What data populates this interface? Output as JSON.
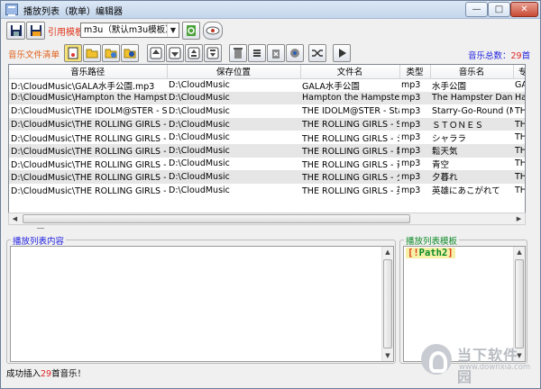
{
  "window": {
    "title": "播放列表（歌单）编辑器",
    "min_glyph": "—",
    "max_glyph": "□",
    "close_glyph": "✕"
  },
  "toolbar": {
    "template_label": "引用模板",
    "template_value": "m3u（默认m3u模板）",
    "buttons": [
      "save-icon",
      "save-as-icon",
      "refresh-icon",
      "view-icon"
    ]
  },
  "files_section": {
    "label": "音乐文件清单",
    "total_label": "音乐总数：",
    "total_value": "29",
    "total_unit": "首",
    "tools": [
      "add-file-icon",
      "add-folder-icon",
      "add-multi-icon",
      "settings-icon",
      "move-top-icon",
      "move-down-icon",
      "move-up-icon",
      "move-bottom-icon",
      "delete-icon",
      "sort-icon",
      "clear-icon",
      "shuffle-icon",
      "play-icon"
    ]
  },
  "table": {
    "columns": [
      "音乐路径",
      "保存位置",
      "文件名",
      "类型",
      "音乐名",
      "专"
    ],
    "rows": [
      [
        "D:\\CloudMusic\\GALA水手公園.mp3",
        "D:\\CloudMusic",
        "GALA水手公園",
        "mp3",
        "水手公園",
        "GA"
      ],
      [
        "D:\\CloudMusic\\Hampton the Hampster",
        "D:\\CloudMusic",
        "Hampton the Hampster",
        "mp3",
        "The Hampster Danc",
        "Ha"
      ],
      [
        "D:\\CloudMusic\\THE IDOLM@STER - Star",
        "D:\\CloudMusic",
        "THE IDOLM@STER - Star",
        "mp3",
        "Starry-Go-Round (M",
        "TH"
      ],
      [
        "D:\\CloudMusic\\THE ROLLING GIRLS - S",
        "D:\\CloudMusic",
        "THE ROLLING GIRLS - S",
        "mp3",
        "ＳＴＯＮＥＳ",
        "TH"
      ],
      [
        "D:\\CloudMusic\\THE ROLLING GIRLS - シ",
        "D:\\CloudMusic",
        "THE ROLLING GIRLS - シ",
        "mp3",
        "シャララ",
        "TH"
      ],
      [
        "D:\\CloudMusic\\THE ROLLING GIRLS - 鬆",
        "D:\\CloudMusic",
        "THE ROLLING GIRLS - 鬆",
        "mp3",
        "鬆天気",
        "TH"
      ],
      [
        "D:\\CloudMusic\\THE ROLLING GIRLS - 青",
        "D:\\CloudMusic",
        "THE ROLLING GIRLS - 青",
        "mp3",
        "青空",
        "TH"
      ],
      [
        "D:\\CloudMusic\\THE ROLLING GIRLS - 夕",
        "D:\\CloudMusic",
        "THE ROLLING GIRLS - 夕",
        "mp3",
        "夕暮れ",
        "TH"
      ],
      [
        "D:\\CloudMusic\\THE ROLLING GIRLS - 英",
        "D:\\CloudMusic",
        "THE ROLLING GIRLS - 英",
        "mp3",
        "英雄にあこがれて",
        "TH"
      ]
    ]
  },
  "playlist_content": {
    "title": "播放列表内容",
    "text": ""
  },
  "playlist_template": {
    "title": "播放列表模板",
    "tag_open": "[!",
    "tag_name": "Path2",
    "tag_close": "]"
  },
  "status": {
    "prefix": "成功插入",
    "count": "29",
    "suffix": "首音乐！"
  },
  "watermark": {
    "text": "当下软件园",
    "url": "www.downxia.com"
  },
  "colors": {
    "accent_red": "#e0361c",
    "blue": "#1e1ee0",
    "green": "#0c8a26",
    "row_alt": "#e6e6e6"
  }
}
